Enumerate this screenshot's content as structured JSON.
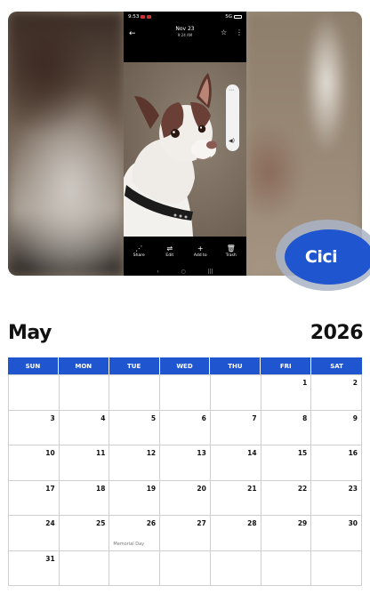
{
  "phone": {
    "status": {
      "time": "9:53",
      "signal": "5G",
      "battery": ""
    },
    "header": {
      "date": "Nov 23",
      "time": "9:24 AM"
    },
    "toolbar": [
      {
        "icon": "share-icon",
        "label": "Share"
      },
      {
        "icon": "edit-icon",
        "label": "Edit"
      },
      {
        "icon": "add-icon",
        "label": "Add to"
      },
      {
        "icon": "trash-icon",
        "label": "Trash"
      }
    ]
  },
  "badge": {
    "name": "Cici"
  },
  "calendar": {
    "month": "May",
    "year": "2026",
    "days_of_week": [
      "SUN",
      "MON",
      "TUE",
      "WED",
      "THU",
      "FRI",
      "SAT"
    ],
    "weeks": [
      [
        "",
        "",
        "",
        "",
        "",
        "1",
        "2"
      ],
      [
        "3",
        "4",
        "5",
        "6",
        "7",
        "8",
        "9"
      ],
      [
        "10",
        "11",
        "12",
        "13",
        "14",
        "15",
        "16"
      ],
      [
        "17",
        "18",
        "19",
        "20",
        "21",
        "22",
        "23"
      ],
      [
        "24",
        "25",
        "26",
        "27",
        "28",
        "29",
        "30"
      ],
      [
        "31",
        "",
        "",
        "",
        "",
        "",
        ""
      ]
    ],
    "holiday": {
      "label": "Memorial Day"
    }
  },
  "colors": {
    "accent": "#1f56cf",
    "text": "#111111",
    "grid": "#cfcfcf"
  }
}
